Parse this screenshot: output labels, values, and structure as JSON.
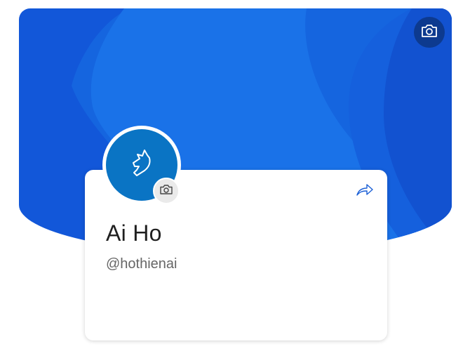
{
  "profile": {
    "name": "Ai Ho",
    "handle": "@hothienai"
  },
  "icons": {
    "cover_camera": "camera-icon",
    "avatar_camera": "camera-icon",
    "share": "share-arrow-icon",
    "avatar_logo": "horse-head-icon"
  },
  "colors": {
    "cover_background": "#1257d9",
    "cover_camera_button": "#0d3a8f",
    "avatar_background": "#0a74c4",
    "share_icon": "#1a5fd6",
    "name_text": "#1f1f1f",
    "handle_text": "#666666"
  }
}
